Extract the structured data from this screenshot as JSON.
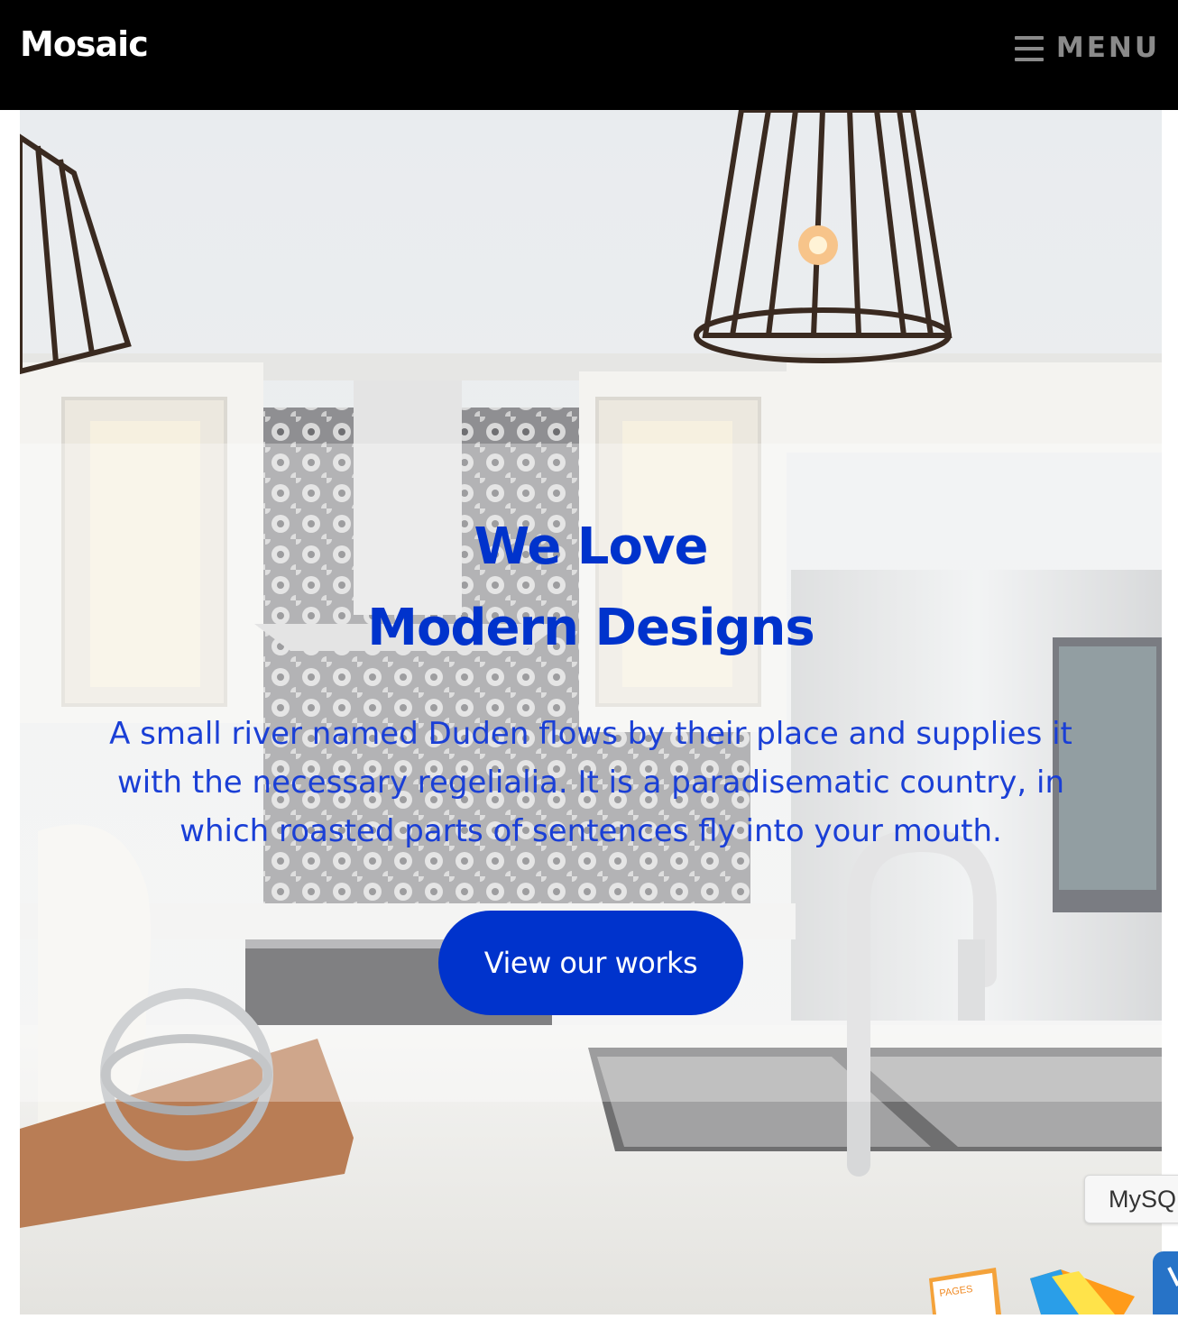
{
  "navbar": {
    "brand": "Mosaic",
    "menu_label": "MENU"
  },
  "hero": {
    "title_line1": "We Love",
    "title_line2": "Modern Designs",
    "description": "A small river named Duden flows by their place and supplies it with the necessary regelialia. It is a paradisematic country, in which roasted parts of sentences fly into your mouth.",
    "cta_label": "View our works"
  },
  "overlay_chip": {
    "label": "MySQ"
  },
  "dock": {
    "pages_label": "PAGES"
  },
  "colors": {
    "navbar_bg": "#000000",
    "brand_text": "#ffffff",
    "menu_text": "#8a8a8a",
    "accent_blue": "#0033cc",
    "button_text": "#ffffff"
  },
  "icons": {
    "menu": "hamburger-icon"
  }
}
